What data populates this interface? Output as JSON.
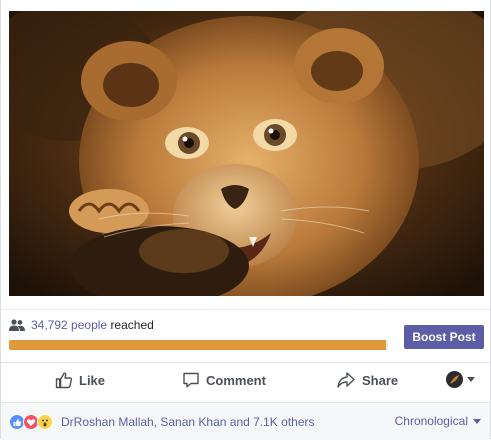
{
  "post": {
    "image": {
      "subject": "lion-cub-photo"
    }
  },
  "reach": {
    "count": "34,792",
    "people_word": "people",
    "reached_word": "reached",
    "progress_fraction": 0.995,
    "bar_color": "#e0993a"
  },
  "boost": {
    "label": "Boost Post",
    "color": "#5b5ea6"
  },
  "actions": {
    "like": "Like",
    "comment": "Comment",
    "share": "Share"
  },
  "reactions": {
    "names": "DrRoshan Mallah, Sanan Khan and 7.1K others",
    "types": [
      "like",
      "love",
      "wow"
    ],
    "sort_label": "Chronological"
  },
  "colors": {
    "accent": "#5b5ea6",
    "muted_text": "#4b4f56"
  }
}
